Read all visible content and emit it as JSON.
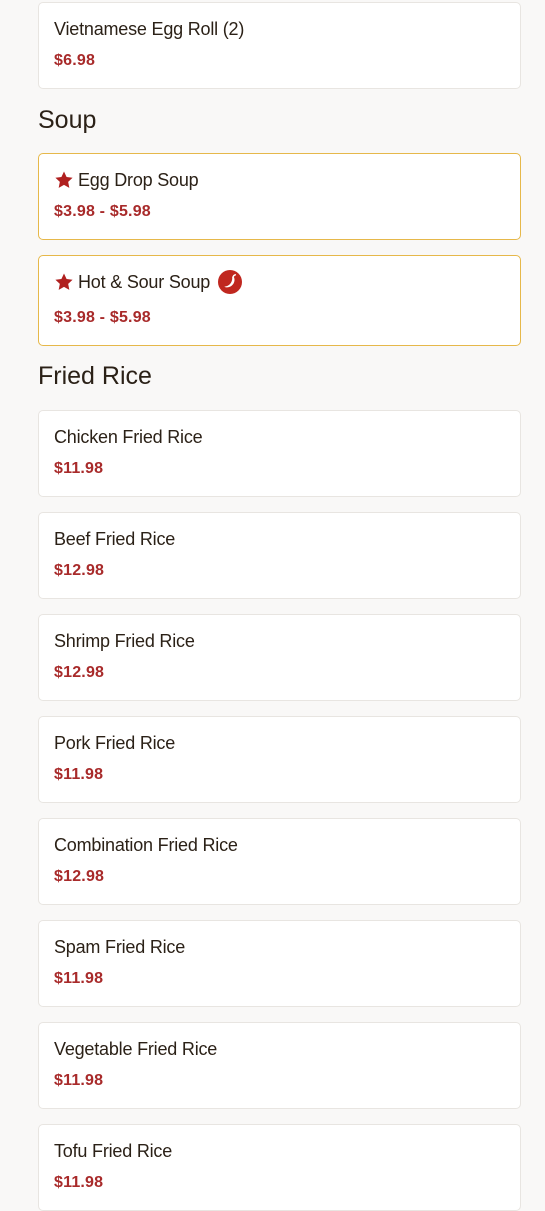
{
  "top_items": [
    {
      "name": "Vietnamese Egg Roll (2)",
      "price": "$6.98"
    }
  ],
  "sections": [
    {
      "title": "Soup",
      "items": [
        {
          "name": "Egg Drop Soup",
          "price": "$3.98 - $5.98",
          "featured": true,
          "spicy": false
        },
        {
          "name": "Hot & Sour Soup",
          "price": "$3.98 - $5.98",
          "featured": true,
          "spicy": true
        }
      ]
    },
    {
      "title": "Fried Rice",
      "items": [
        {
          "name": "Chicken Fried Rice",
          "price": "$11.98"
        },
        {
          "name": "Beef Fried Rice",
          "price": "$12.98"
        },
        {
          "name": "Shrimp Fried Rice",
          "price": "$12.98"
        },
        {
          "name": "Pork Fried Rice",
          "price": "$11.98"
        },
        {
          "name": "Combination Fried Rice",
          "price": "$12.98"
        },
        {
          "name": "Spam Fried Rice",
          "price": "$11.98"
        },
        {
          "name": "Vegetable Fried Rice",
          "price": "$11.98"
        },
        {
          "name": "Tofu Fried Rice",
          "price": "$11.98"
        }
      ]
    }
  ],
  "icons": {
    "featured": "star-icon",
    "spicy": "chili-pepper-icon"
  },
  "colors": {
    "price": "#a82a2a",
    "featured_border": "#e6b84a",
    "star": "#b0201f",
    "pepper": "#c0271f"
  }
}
